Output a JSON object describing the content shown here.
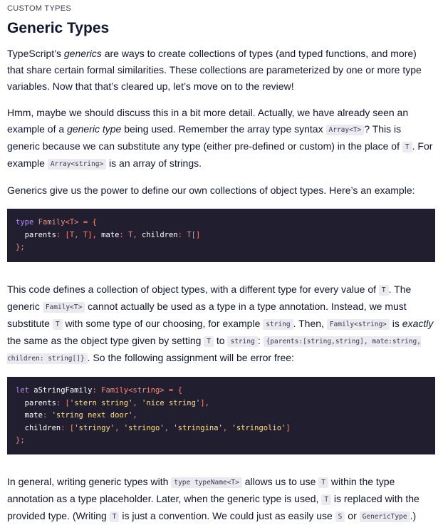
{
  "section_label": "CUSTOM TYPES",
  "title": "Generic Types",
  "p1": {
    "a": "TypeScript’s ",
    "em": "generics",
    "b": " are ways to create collections of types (and typed functions, and more) that share certain formal similarities. These collections are parameterized by one or more type variables. Now that that’s cleared up, let’s move on to the review!"
  },
  "p2": {
    "a": "Hmm, maybe we should discuss this in a bit more detail. Actually, we have already seen an example of a ",
    "em": "generic type",
    "b": " being used. Remember the array type syntax ",
    "c1": "Array<T>",
    "c": "? This is generic because we can substitute any type (either pre-defined or custom) in the place of ",
    "c2": "T",
    "d": ". For example ",
    "c3": "Array<string>",
    "e": " is an array of strings."
  },
  "p3": "Generics give us the power to define our own collections of object types. Here’s an example:",
  "code1": {
    "l1": {
      "kw": "type",
      "name": " Family<T> = {"
    },
    "l2": {
      "prop1": "  parents",
      "v1": ": [T, T], ",
      "prop2": "mate",
      "v2": ": T, ",
      "prop3": "children",
      "v3": ": T[]"
    },
    "l3": "};"
  },
  "p4": {
    "a": "This code defines a collection of object types, with a different type for every value of ",
    "c1": "T",
    "b": ". The generic ",
    "c2": "Family<T>",
    "c": " cannot actually be used as a type in a type annotation. Instead, we must substitute ",
    "c3": "T",
    "d": " with some type of our choosing, for example ",
    "c4": "string",
    "e": ". Then, ",
    "c5": "Family<string>",
    "f": " is ",
    "em": "exactly",
    "g": " the same as the object type given by setting ",
    "c6": "T",
    "h": " to ",
    "c7": "string",
    "i": ": ",
    "c8": "{parents:[string,string], mate:string, children: string[]}",
    "j": ". So the following assignment will be error free:"
  },
  "code2": {
    "l1": {
      "kw": "let",
      "name": " aStringFamily",
      "colon": ": ",
      "type": "Family<string>",
      "rest": " = {"
    },
    "l2": {
      "prop": "  parents",
      "sep": ": [",
      "s1": "'stern string'",
      "comma": ", ",
      "s2": "'nice string'",
      "end": "],"
    },
    "l3": {
      "prop": "  mate",
      "sep": ": ",
      "s1": "'string next door'",
      "end": ","
    },
    "l4": {
      "prop": "  children",
      "sep": ": [",
      "s1": "'stringy'",
      "c1": ", ",
      "s2": "'stringo'",
      "c2": ", ",
      "s3": "'stringina'",
      "c3": ", ",
      "s4": "'stringolio'",
      "end": "]"
    },
    "l5": "};"
  },
  "p5": {
    "a": "In general, writing generic types with ",
    "c1": "type typeName<T>",
    "b": " allows us to use ",
    "c2": "T",
    "c": " within the type annotation as a type placeholder. Later, when the generic type is used, ",
    "c3": "T",
    "d": " is replaced with the provided type. (Writing ",
    "c4": "T",
    "e": " is just a convention. We could just as easily use ",
    "c5": "S",
    "f": " or ",
    "c6": "GenericType",
    "g": ".)"
  }
}
